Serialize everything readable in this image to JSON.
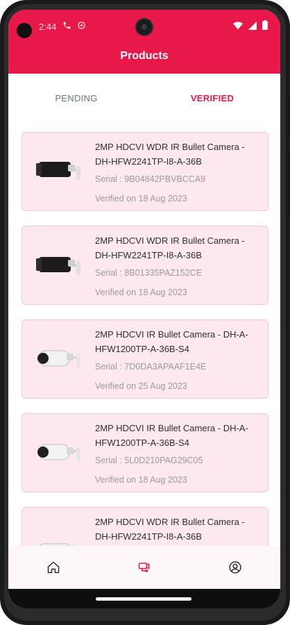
{
  "status_bar": {
    "time": "2:44",
    "left_icons": [
      "phone-icon",
      "sync-icon"
    ],
    "right_icons": [
      "wifi-icon",
      "signal-icon",
      "battery-icon"
    ]
  },
  "header": {
    "title": "Products"
  },
  "tabs": [
    {
      "label": "PENDING",
      "active": false
    },
    {
      "label": "VERIFIED",
      "active": true
    }
  ],
  "products": [
    {
      "title": "2MP HDCVI WDR IR Bullet Camera - DH-HFW2241TP-I8-A-36B",
      "serial": "Serial :  9B04842PBVBCCA9",
      "verified": "Verified on 18 Aug 2023",
      "thumb": "camera-black-icon"
    },
    {
      "title": "2MP HDCVI WDR IR Bullet Camera - DH-HFW2241TP-I8-A-36B",
      "serial": "Serial :  8B01335PAZ152CE",
      "verified": "Verified on 18 Aug 2023",
      "thumb": "camera-black-icon"
    },
    {
      "title": "2MP HDCVI IR Bullet Camera - DH-A-HFW1200TP-A-36B-S4",
      "serial": "Serial :  7D0DA3APAAF1E4E",
      "verified": "Verified on 25 Aug 2023",
      "thumb": "camera-white-icon"
    },
    {
      "title": "2MP HDCVI IR Bullet Camera - DH-A-HFW1200TP-A-36B-S4",
      "serial": "Serial :  5L0D210PAG29C05",
      "verified": "Verified on 18 Aug 2023",
      "thumb": "camera-white-icon"
    },
    {
      "title": "2MP HDCVI WDR IR Bullet Camera - DH-HFW2241TP-I8-A-36B",
      "serial": "",
      "verified": "",
      "thumb": "camera-white-icon"
    }
  ],
  "bottom_nav": [
    {
      "icon": "home-icon",
      "active": false
    },
    {
      "icon": "verified-products-icon",
      "active": true
    },
    {
      "icon": "profile-icon",
      "active": false
    }
  ],
  "colors": {
    "accent": "#e8194a",
    "card_bg": "#fde9ed",
    "card_border": "#f7c8d2",
    "muted_text": "#9a9a9a"
  }
}
